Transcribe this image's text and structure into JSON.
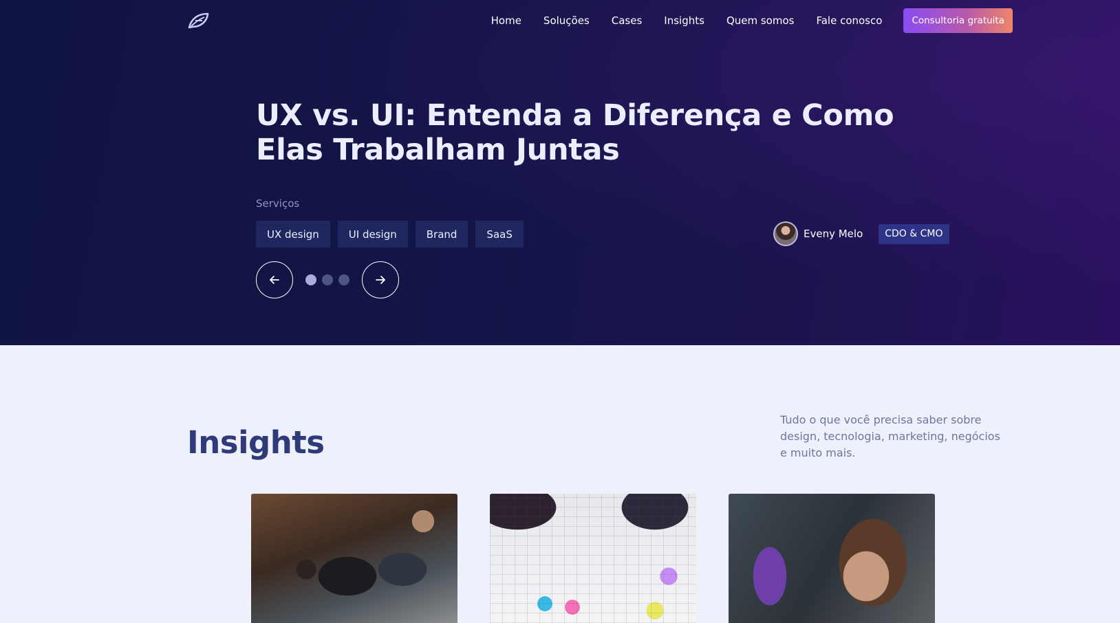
{
  "nav": {
    "links": [
      "Home",
      "Soluções",
      "Cases",
      "Insights",
      "Quem somos",
      "Fale conosco"
    ],
    "cta_label": "Consultoria gratuita"
  },
  "hero": {
    "title": "UX vs. UI: Entenda a Diferença e Como Elas Trabalham Juntas",
    "services_label": "Serviços",
    "tags": [
      "UX design",
      "UI design",
      "Brand",
      "SaaS"
    ],
    "author": {
      "name": "Eveny Melo",
      "role": "CDO & CMO"
    },
    "carousel": {
      "slides": 3,
      "active_index": 0
    }
  },
  "insights": {
    "title": "Insights",
    "description": "Tudo o que você precisa saber sobre design, tecnologia, marketing, negócios e muito mais."
  },
  "icons": {
    "logo": "leaf-logo-icon",
    "prev": "arrow-left-icon",
    "next": "arrow-right-icon"
  },
  "colors": {
    "hero_bg": "#141548",
    "accent_gradient_start": "#8a4bf5",
    "accent_gradient_end": "#f0856a",
    "heading": "#2f3a78",
    "tag_bg": "#1f2660"
  }
}
